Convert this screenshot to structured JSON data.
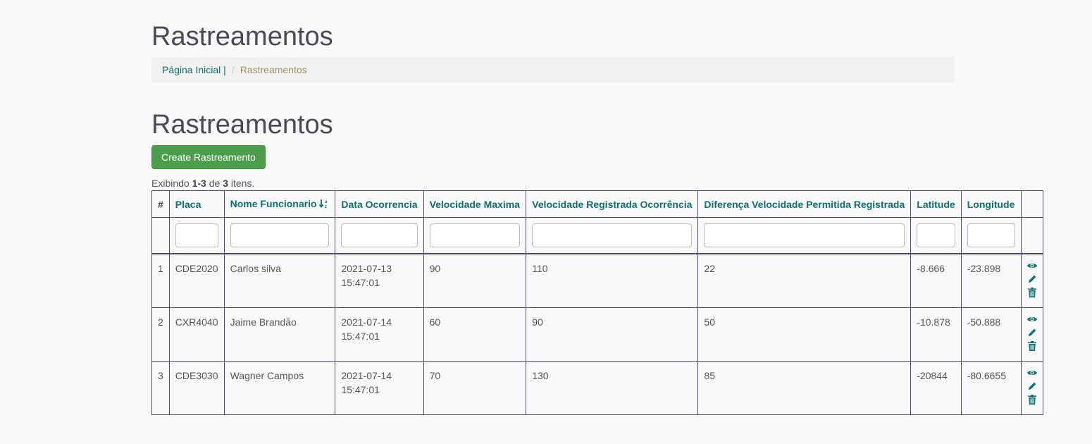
{
  "page": {
    "title": "Rastreamentos",
    "heading": "Rastreamentos"
  },
  "breadcrumb": {
    "home_label": "Página Inicial |",
    "separator": "/",
    "current": "Rastreamentos"
  },
  "toolbar": {
    "create_label": "Create Rastreamento"
  },
  "summary": {
    "prefix": "Exibindo ",
    "range": "1-3",
    "middle": " de ",
    "total": "3",
    "suffix": " itens."
  },
  "table": {
    "headers": [
      "#",
      "Placa",
      "Nome Funcionario",
      "Data Ocorrencia",
      "Velocidade Maxima",
      "Velocidade Registrada Ocorrência",
      "Diferença Velocidade Permitida Registrada",
      "Latitude",
      "Longitude"
    ],
    "sorted_column_icon": "sort-alpha-down-icon",
    "rows": [
      {
        "num": "1",
        "placa": "CDE2020",
        "nome": "Carlos silva",
        "data": "2021-07-13",
        "hora": "15:47:01",
        "vel_max": "90",
        "vel_reg": "110",
        "diferenca": "22",
        "latitude": "-8.666",
        "longitude": "-23.898"
      },
      {
        "num": "2",
        "placa": "CXR4040",
        "nome": "Jaime Brandão",
        "data": "2021-07-14",
        "hora": "15:47:01",
        "vel_max": "60",
        "vel_reg": "90",
        "diferenca": "50",
        "latitude": "-10.878",
        "longitude": "-50.888"
      },
      {
        "num": "3",
        "placa": "CDE3030",
        "nome": "Wagner Campos",
        "data": "2021-07-14",
        "hora": "15:47:01",
        "vel_max": "70",
        "vel_reg": "130",
        "diferenca": "85",
        "latitude": "-20844",
        "longitude": "-80.6655"
      }
    ],
    "row_actions": [
      "view-icon",
      "edit-icon",
      "delete-icon"
    ]
  },
  "colors": {
    "accent": "#0d7070",
    "create_button": "#4c9e4c",
    "breadcrumb_active": "#a19263",
    "border": "#4d4f66"
  }
}
